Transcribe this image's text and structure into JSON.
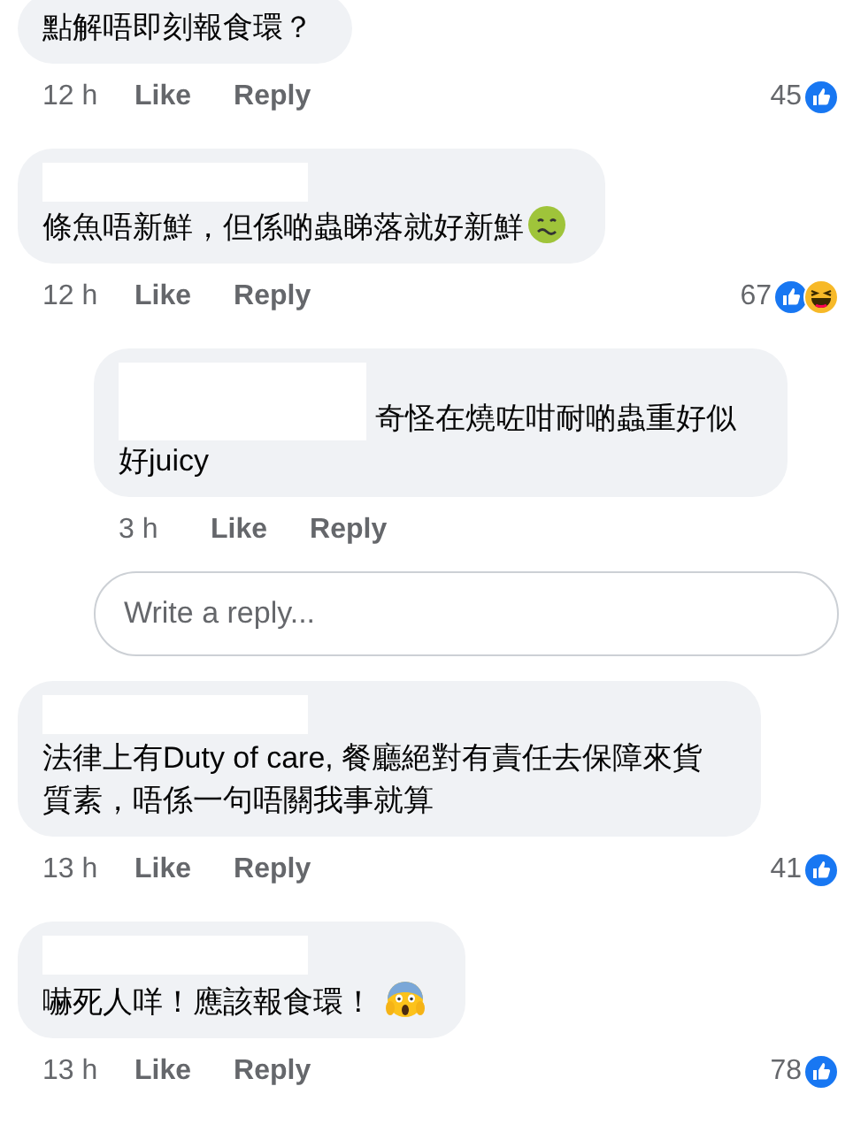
{
  "comments": [
    {
      "redacted_name": false,
      "text": "點解唔即刻報食環？",
      "time": "12 h",
      "like": "Like",
      "reply": "Reply",
      "count": "45",
      "reactions": [
        {
          "kind": "like"
        }
      ]
    },
    {
      "redacted_name": true,
      "text": "條魚唔新鮮，但係啲蟲睇落就好新鮮",
      "emoji": {
        "kind": "sick"
      },
      "time": "12 h",
      "like": "Like",
      "reply": "Reply",
      "count": "67",
      "reactions": [
        {
          "kind": "like"
        },
        {
          "kind": "haha"
        }
      ],
      "replies": [
        {
          "redacted_name": true,
          "inline_name": true,
          "text": "奇怪在燒咗咁耐啲蟲重好似好juicy",
          "time": "3 h",
          "like": "Like",
          "reply": "Reply"
        }
      ],
      "reply_box": {
        "placeholder": "Write a reply..."
      }
    },
    {
      "redacted_name": true,
      "text": "法律上有Duty of care, 餐廳絕對有責任去保障來貨質素，唔係一句唔關我事就算",
      "time": "13 h",
      "like": "Like",
      "reply": "Reply",
      "count": "41",
      "reactions": [
        {
          "kind": "like"
        }
      ]
    },
    {
      "redacted_name": true,
      "text": "嚇死人咩！應該報食環！",
      "emoji": {
        "kind": "scream"
      },
      "time": "13 h",
      "like": "Like",
      "reply": "Reply",
      "count": "78",
      "reactions": [
        {
          "kind": "like"
        }
      ]
    }
  ]
}
